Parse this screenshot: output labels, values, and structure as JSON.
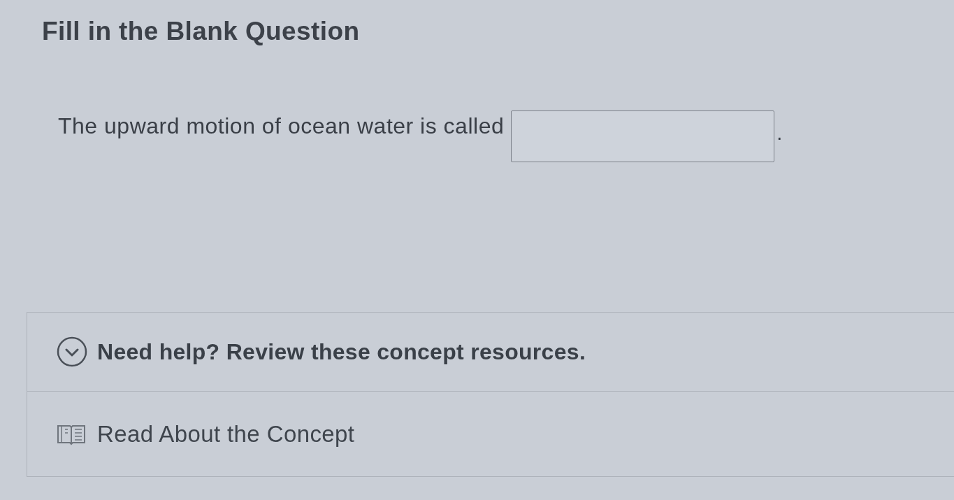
{
  "title": "Fill in the Blank Question",
  "question": {
    "prompt": "The upward motion of ocean water is called",
    "after_blank": "."
  },
  "help": {
    "label": "Need help? Review these concept resources.",
    "resources": [
      {
        "label": "Read About the Concept"
      }
    ]
  }
}
